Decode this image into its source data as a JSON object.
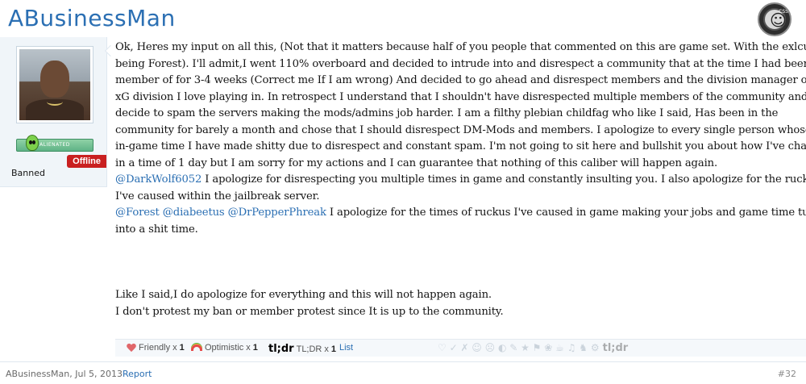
{
  "page": {
    "title": "ABusinessMan"
  },
  "game_logo": {
    "icon": "counter-strike-source-icon",
    "tag": "CSS"
  },
  "user": {
    "rank_label": "ALIENATED",
    "status": "Offline",
    "title": "Banned"
  },
  "message": {
    "lines": [
      "Ok, Heres my input on all this, (Not that it matters because half of you people that commented on this are game set. With the exlcusion",
      "being Forest). I'll admit,I went 110% overboard and decided to intrude into and disrespect a community that at the time I had been a",
      "member of for 3-4 weeks (Correct me If I am wrong) And decided to go ahead and disrespect members and the division manager of the",
      "xG division I love playing in. In retrospect I understand that I shouldn't have disrespected multiple members of the community and",
      "decide to spam the servers making the mods/admins job harder. I am a filthy plebian childfag who like I said, Has been in the",
      "community for barely a month and chose that I should disrespect DM-Mods and members. I apologize to every single person whose",
      "in-game time I have made shitty due to disrespect and constant spam. I'm not going to sit here and bullshit you about how I've changed",
      "in a time of 1 day but I am sorry for my actions and I can guarantee that nothing of this caliber will happen again."
    ],
    "mention1": "@DarkWolf6052",
    "mention1_text_a": " I apologize for disrespecting you multiple times in game and constantly insulting you. I also apologize for the ruckus",
    "mention1_text_b": "I've caused within the jailbreak server.",
    "mention2": "@Forest",
    "mention3": "@diabeetus",
    "mention4": "@DrPepperPhreak",
    "mention2_text_a": " I apologize for the times of ruckus I've caused in game making your jobs and game time turn",
    "mention2_text_b": "into a shit time.",
    "closing_1": "Like I said,I do apologize for everything and this will not happen again.",
    "closing_2": "I don't protest my ban or member protest since It is up to the community."
  },
  "ratings": [
    {
      "icon": "heart-icon",
      "label": "Friendly",
      "x": "x",
      "count": "1"
    },
    {
      "icon": "rainbow-icon",
      "label": "Optimistic",
      "x": "x",
      "count": "1"
    },
    {
      "icon": "tldr-icon",
      "icon_text": "tl;dr",
      "label": "TL;DR",
      "x": "x",
      "count": "1"
    }
  ],
  "ratings_list_link": "List",
  "rating_icons_faded": "♡ ✓ ✗ ☺ ☹ ◐ ✎ ★ ⚑ ❀ ☕ ♫ ♞ ⚙",
  "rating_icons_faded_tldr": "tl;dr",
  "footer": {
    "byline": "ABusinessMan, Jul 5, 2013",
    "report": "Report",
    "post_number": "#32"
  }
}
